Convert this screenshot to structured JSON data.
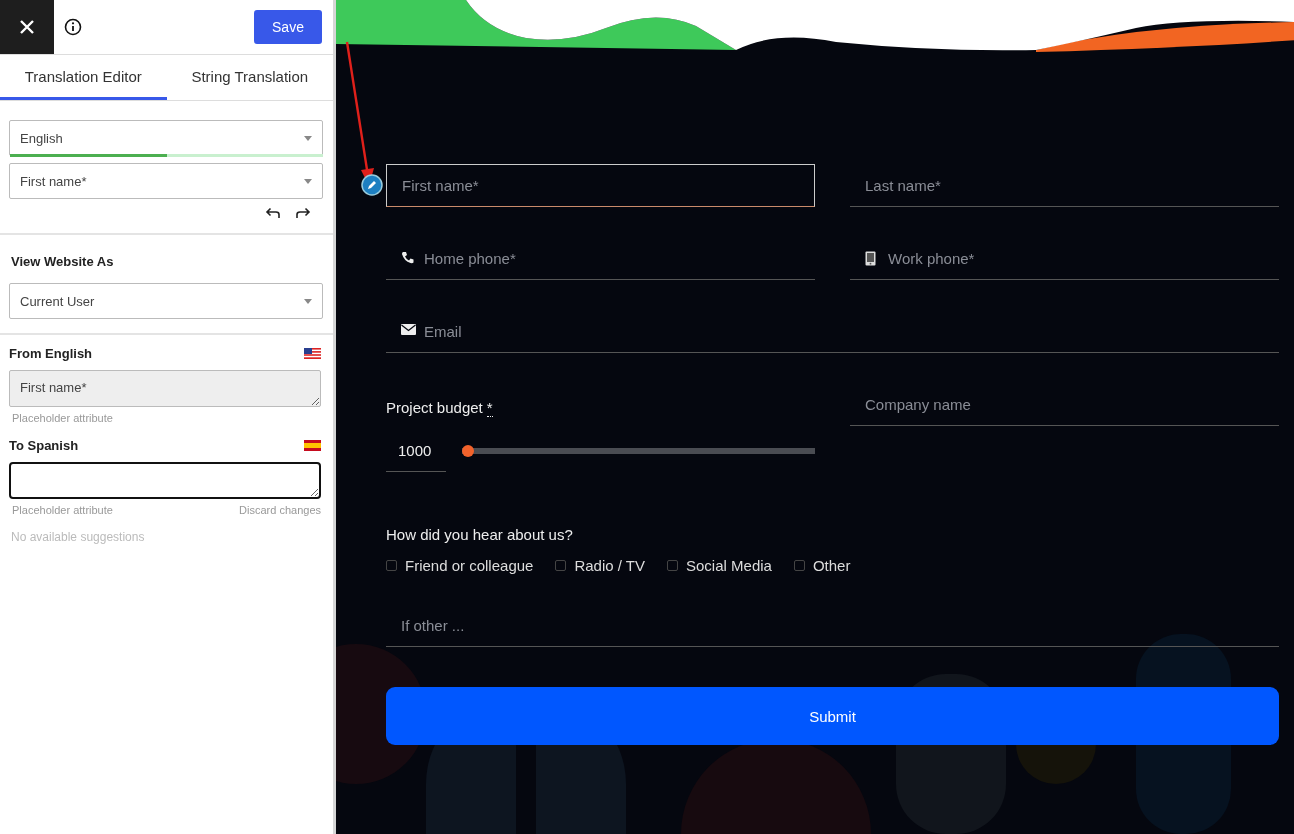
{
  "toolbar": {
    "save": "Save"
  },
  "tabs": [
    {
      "label": "Translation Editor",
      "selected": true
    },
    {
      "label": "String Translation",
      "selected": false
    }
  ],
  "language_select": {
    "value": "English",
    "level": 0.5
  },
  "string_select": {
    "value": "First name*"
  },
  "view_as": {
    "heading": "View Website As",
    "value": "Current User"
  },
  "source": {
    "heading": "From English",
    "value": "First name*",
    "hint": "Placeholder attribute"
  },
  "target": {
    "heading": "To Spanish",
    "hint": "Placeholder attribute",
    "discard": "Discard changes"
  },
  "suggestions": "No available suggestions",
  "form": {
    "rows": [
      [
        {
          "kind": "text",
          "placeholder": "First name*",
          "focused": true
        },
        {
          "kind": "text",
          "placeholder": "Last name*",
          "focused": false
        }
      ],
      [
        {
          "kind": "phone",
          "placeholder": "Home phone*",
          "focused": false
        },
        {
          "kind": "mobile",
          "placeholder": "Work phone*",
          "focused": false
        }
      ],
      [
        {
          "kind": "email",
          "placeholder": "Email",
          "focused": false
        }
      ],
      [
        {
          "kind": "range",
          "label": "Project budget",
          "mark": "*",
          "value": "1000",
          "level": 0
        },
        {
          "kind": "text",
          "placeholder": "Company name",
          "focused": false
        }
      ]
    ],
    "question": "How did you hear about us?",
    "options": [
      {
        "label": "Friend or colleague",
        "checked": false
      },
      {
        "label": "Radio / TV",
        "checked": false
      },
      {
        "label": "Social Media",
        "checked": false
      },
      {
        "label": "Other",
        "checked": false
      }
    ],
    "other": {
      "placeholder": "If other ...",
      "focused": false
    },
    "submit": "Submit"
  }
}
